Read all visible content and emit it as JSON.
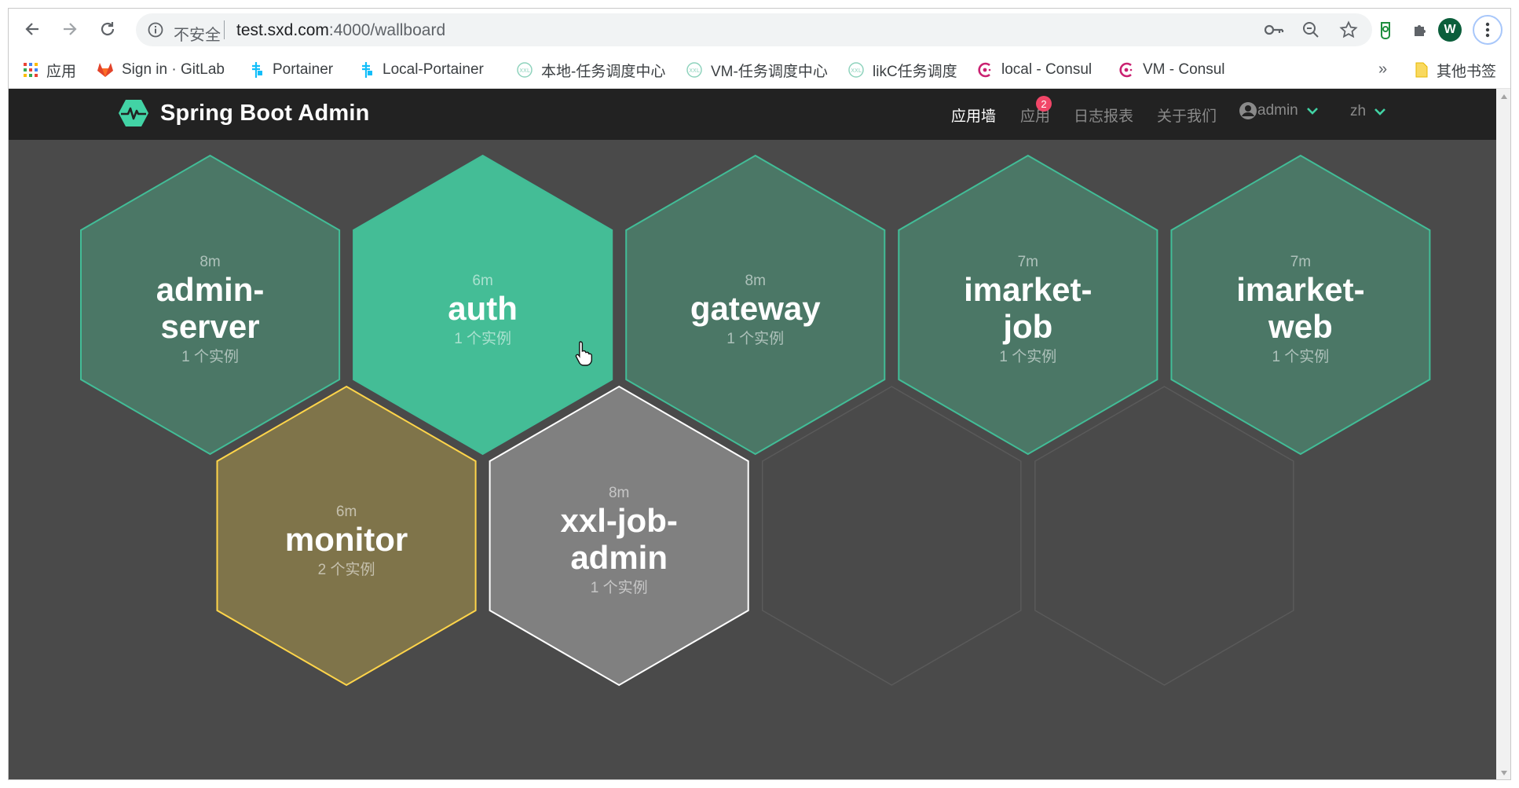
{
  "browser": {
    "omnibox": {
      "security_label": "不安全",
      "url_host": "test.sxd.com",
      "url_rest": ":4000/wallboard"
    },
    "profile_initial": "W"
  },
  "bookmarks": {
    "items": [
      {
        "label": "应用",
        "icon": "apps-grid-icon"
      },
      {
        "label": "Sign in · GitLab",
        "icon": "gitlab-icon"
      },
      {
        "label": "Portainer",
        "icon": "portainer-icon"
      },
      {
        "label": "Local-Portainer",
        "icon": "portainer-icon"
      },
      {
        "label": "本地-任务调度中心",
        "icon": "xxl-job-icon"
      },
      {
        "label": "VM-任务调度中心",
        "icon": "xxl-job-icon"
      },
      {
        "label": "likC任务调度",
        "icon": "xxl-job-icon"
      },
      {
        "label": "local - Consul",
        "icon": "consul-icon"
      },
      {
        "label": "VM - Consul",
        "icon": "consul-icon"
      }
    ],
    "more": "»",
    "other": "其他书签"
  },
  "app": {
    "brand": "Spring Boot Admin",
    "nav": {
      "wallboard": "应用墙",
      "applications": "应用",
      "applications_badge": "2",
      "journal": "日志报表",
      "about": "关于我们",
      "user": "admin",
      "language": "zh"
    },
    "colors": {
      "navbar": "#222222",
      "background": "#4a4a4a",
      "up": "#42bd97",
      "up_fill": "#4b7766",
      "up_hover_fill": "#44bd96",
      "warning": "#ffd54a",
      "warning_fill": "#7f744a",
      "offline": "#ffffff",
      "offline_fill": "#808080"
    },
    "applications": [
      {
        "name_lines": [
          "admin-",
          "server"
        ],
        "ago": "8m",
        "instances": "1 个实例",
        "status": "up"
      },
      {
        "name_lines": [
          "auth"
        ],
        "ago": "6m",
        "instances": "1 个实例",
        "status": "up-hover"
      },
      {
        "name_lines": [
          "gateway"
        ],
        "ago": "8m",
        "instances": "1 个实例",
        "status": "up"
      },
      {
        "name_lines": [
          "imarket-",
          "job"
        ],
        "ago": "7m",
        "instances": "1 个实例",
        "status": "up"
      },
      {
        "name_lines": [
          "imarket-",
          "web"
        ],
        "ago": "7m",
        "instances": "1 个实例",
        "status": "up"
      },
      {
        "name_lines": [
          "monitor"
        ],
        "ago": "6m",
        "instances": "2 个实例",
        "status": "warning"
      },
      {
        "name_lines": [
          "xxl-job-",
          "admin"
        ],
        "ago": "8m",
        "instances": "1 个实例",
        "status": "offline"
      }
    ]
  }
}
